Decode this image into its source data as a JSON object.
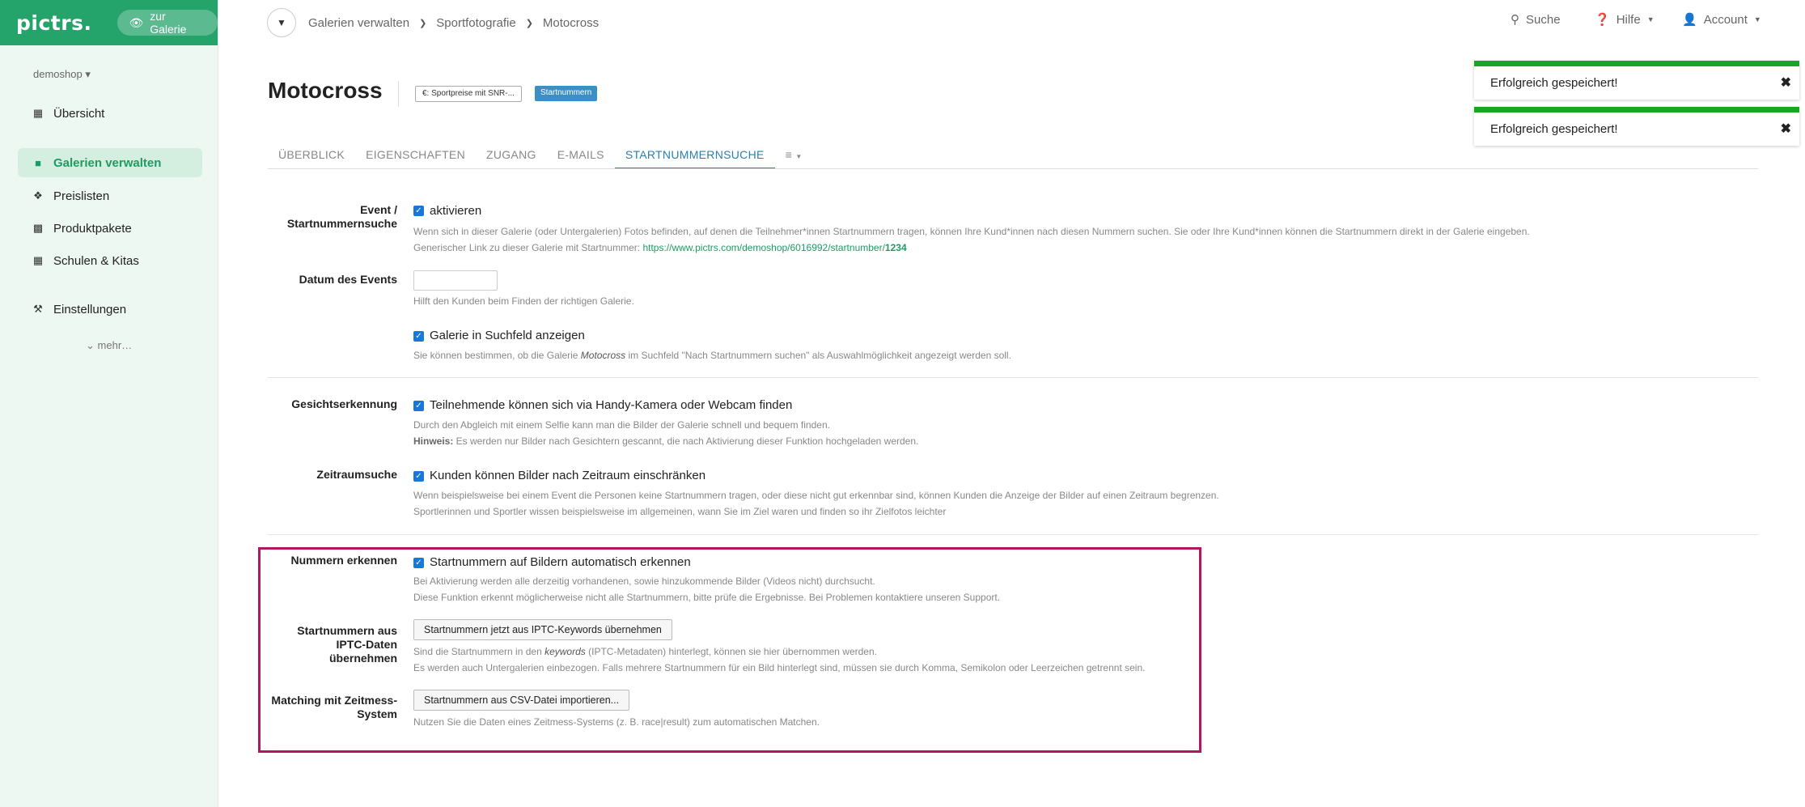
{
  "sidebar": {
    "logo": "pictrs.",
    "gallery_button": "zur Galerie",
    "shop": "demoshop ▾",
    "items": [
      {
        "label": "Übersicht",
        "icon": "calendar-icon"
      },
      {
        "label": "Galerien verwalten",
        "icon": "folder-icon"
      },
      {
        "label": "Preislisten",
        "icon": "tags-icon"
      },
      {
        "label": "Produktpakete",
        "icon": "grid-icon"
      },
      {
        "label": "Schulen & Kitas",
        "icon": "qr-icon"
      },
      {
        "label": "Einstellungen",
        "icon": "wrench-icon"
      }
    ],
    "more": "mehr…"
  },
  "topbar": {
    "breadcrumb": [
      "Galerien verwalten",
      "Sportfotografie",
      "Motocross"
    ],
    "search": "Suche",
    "help": "Hilfe",
    "account": "Account"
  },
  "toasts": [
    "Erfolgreich gespeichert!",
    "Erfolgreich gespeichert!"
  ],
  "page": {
    "title": "Motocross",
    "price_badge": "€: Sportpreise mit SNR-...",
    "snr_badge": "Startnummern"
  },
  "tabs": [
    "ÜBERBLICK",
    "EIGENSCHAFTEN",
    "ZUGANG",
    "E-MAILS",
    "STARTNUMMERNSUCHE"
  ],
  "form": {
    "event": {
      "label_1": "Event /",
      "label_2": "Startnummernsuche",
      "checkbox": "aktivieren",
      "hint": "Wenn sich in dieser Galerie (oder Untergalerien) Fotos befinden, auf denen die Teilnehmer*innen Startnummern tragen, können Ihre Kund*innen nach diesen Nummern suchen. Sie oder Ihre Kund*innen können die Startnummern direkt in der Galerie eingeben.",
      "link_prefix": "Generischer Link zu dieser Galerie mit Startnummer: ",
      "link": "https://www.pictrs.com/demoshop/6016992/startnumber/",
      "link_num": "1234"
    },
    "date": {
      "label": "Datum des Events",
      "hint": "Hilft den Kunden beim Finden der richtigen Galerie."
    },
    "searchfield": {
      "checkbox": "Galerie in Suchfeld anzeigen",
      "hint_a": "Sie können bestimmen, ob die Galerie ",
      "hint_gallery": "Motocross",
      "hint_b": " im Suchfeld \"Nach Startnummern suchen\" als Auswahlmöglichkeit angezeigt werden soll."
    },
    "face": {
      "label": "Gesichtserkennung",
      "checkbox": "Teilnehmende können sich via Handy-Kamera oder Webcam finden",
      "hint_1": "Durch den Abgleich mit einem Selfie kann man die Bilder der Galerie schnell und bequem finden.",
      "hint_bold": "Hinweis:",
      "hint_2": " Es werden nur Bilder nach Gesichtern gescannt, die nach Aktivierung dieser Funktion hochgeladen werden."
    },
    "time": {
      "label": "Zeitraumsuche",
      "checkbox": "Kunden können Bilder nach Zeitraum einschränken",
      "hint_1": "Wenn beispielsweise bei einem Event die Personen keine Startnummern tragen, oder diese nicht gut erkennbar sind, können Kunden die Anzeige der Bilder auf einen Zeitraum begrenzen.",
      "hint_2": "Sportlerinnen und Sportler wissen beispielsweise im allgemeinen, wann Sie im Ziel waren und finden so ihr Zielfotos leichter"
    },
    "numbers": {
      "label": "Nummern erkennen",
      "checkbox": "Startnummern auf Bildern automatisch erkennen",
      "hint_1": "Bei Aktivierung werden alle derzeitig vorhandenen, sowie hinzukommende Bilder (Videos nicht) durchsucht.",
      "hint_2": "Diese Funktion erkennt möglicherweise nicht alle Startnummern, bitte prüfe die Ergebnisse. Bei Problemen kontaktiere unseren Support."
    },
    "iptc": {
      "label_1": "Startnummern aus",
      "label_2": "IPTC-Daten",
      "label_3": "übernehmen",
      "button": "Startnummern jetzt aus IPTC-Keywords übernehmen",
      "hint_a": "Sind die Startnummern in den ",
      "hint_keywords": "keywords",
      "hint_b": " (IPTC-Metadaten) hinterlegt, können sie hier übernommen werden.",
      "hint_2": "Es werden auch Untergalerien einbezogen. Falls mehrere Startnummern für ein Bild hinterlegt sind, müssen sie durch Komma, Semikolon oder Leerzeichen getrennt sein."
    },
    "matching": {
      "label_1": "Matching mit Zeitmess-",
      "label_2": "System",
      "button": "Startnummern aus CSV-Datei importieren...",
      "hint": "Nutzen Sie die Daten eines Zeitmess-Systems (z. B. race|result) zum automatischen Matchen."
    }
  },
  "colors": {
    "brand": "#24a36b",
    "active_tab": "#2a7fb0",
    "toast": "#1aa522",
    "highlight": "#b0175f"
  }
}
